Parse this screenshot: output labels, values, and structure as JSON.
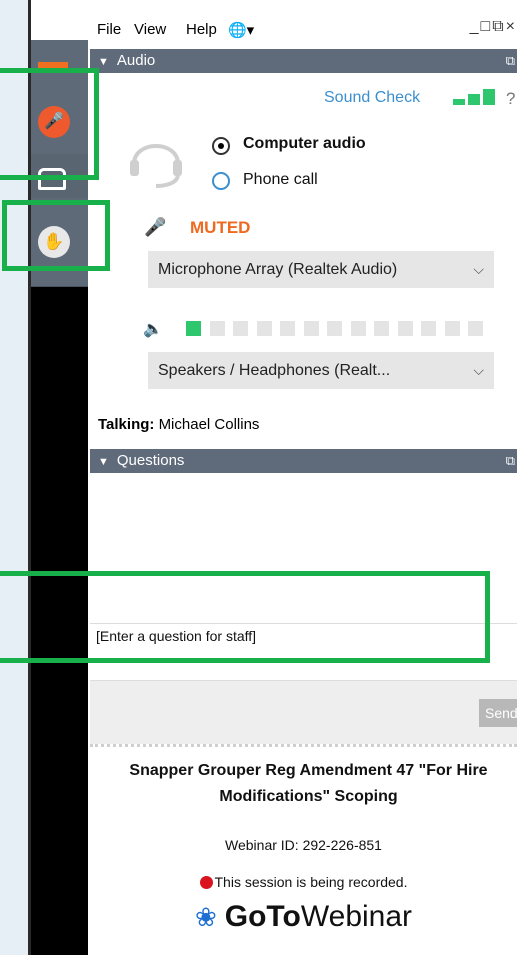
{
  "menubar": {
    "file": "File",
    "view": "View",
    "help": "Help",
    "globe_icon": "globe-icon",
    "window_controls": "_□⧉×"
  },
  "audio": {
    "section_title": "Audio",
    "sound_check": "Sound Check",
    "help": "?",
    "options": [
      {
        "label": "Computer audio",
        "selected": true
      },
      {
        "label": "Phone call",
        "selected": false
      }
    ],
    "mute_status": "MUTED",
    "microphone": "Microphone Array (Realtek Audio)",
    "speakers": "Speakers / Headphones (Realt...",
    "level_segments": 13,
    "level_active": 1,
    "colors": {
      "accent_blue": "#3a8fd0",
      "muted_orange": "#ee6a20",
      "level_green": "#2ec76e"
    }
  },
  "talking": {
    "label": "Talking:",
    "name": "Michael Collins"
  },
  "questions": {
    "section_title": "Questions",
    "input_placeholder": "[Enter a question for staff]",
    "send_label": "Send"
  },
  "webinar": {
    "title": "Snapper Grouper Reg Amendment 47 \"For Hire Modifications\" Scoping",
    "id_text": "Webinar ID: 292-226-851",
    "recording_text": "This session is being recorded.",
    "brand_goto": "GoTo",
    "brand_webinar": "Webinar"
  },
  "highlight_color": "#18b04a"
}
